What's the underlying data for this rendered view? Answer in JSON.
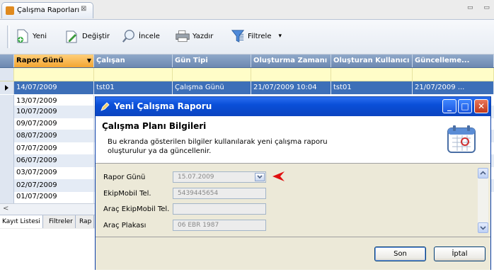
{
  "tab": {
    "title": "Çalışma Raporları",
    "close_glyph": "⊠"
  },
  "window_controls": "▭ ▭",
  "toolbar": [
    {
      "name": "new",
      "label": "Yeni",
      "icon": "new-doc-icon"
    },
    {
      "name": "edit",
      "label": "Değiştir",
      "icon": "edit-icon"
    },
    {
      "name": "review",
      "label": "İncele",
      "icon": "magnifier-icon"
    },
    {
      "name": "print",
      "label": "Yazdır",
      "icon": "printer-icon"
    },
    {
      "name": "filter",
      "label": "Filtrele",
      "icon": "funnel-icon"
    }
  ],
  "filter_dropdown_glyph": "▾",
  "grid": {
    "columns": [
      "Rapor Günü",
      "Çalışan",
      "Gün Tipi",
      "Oluşturma Zamanı",
      "Oluşturan Kullanıcı",
      "Güncelleme..."
    ],
    "sort_glyph": "▼",
    "selected_row": [
      "14/07/2009",
      "tst01",
      "Çalışma Günü",
      "21/07/2009 10:04",
      "tst01",
      "21/07/2009 ..."
    ],
    "dates": [
      "13/07/2009",
      "10/07/2009",
      "09/07/2009",
      "08/07/2009",
      "07/07/2009",
      "06/07/2009",
      "03/07/2009",
      "02/07/2009",
      "01/07/2009"
    ],
    "scroll_left_glyph": "<"
  },
  "bottom_tabs": [
    "Kayıt Listesi",
    "Filtreler",
    "Rap"
  ],
  "dialog": {
    "title": "Yeni Çalışma Raporu",
    "controls": {
      "minimize": "_",
      "maximize": "□",
      "close": "✕"
    },
    "heading": "Çalışma Planı Bilgileri",
    "description": "Bu ekranda gösterilen bilgiler kullanılarak yeni çalışma raporu oluşturulur ya da güncellenir.",
    "fields": [
      {
        "label": "Rapor Günü",
        "value": "15.07.2009"
      },
      {
        "label": "EkipMobil Tel.",
        "value": "5439445654"
      },
      {
        "label": "Araç EkipMobil Tel.",
        "value": ""
      },
      {
        "label": "Araç Plakası",
        "value": "06 EBR 1987"
      }
    ],
    "ok_label": "Son",
    "cancel_label": "İptal",
    "pointer_color": "#e01010"
  }
}
